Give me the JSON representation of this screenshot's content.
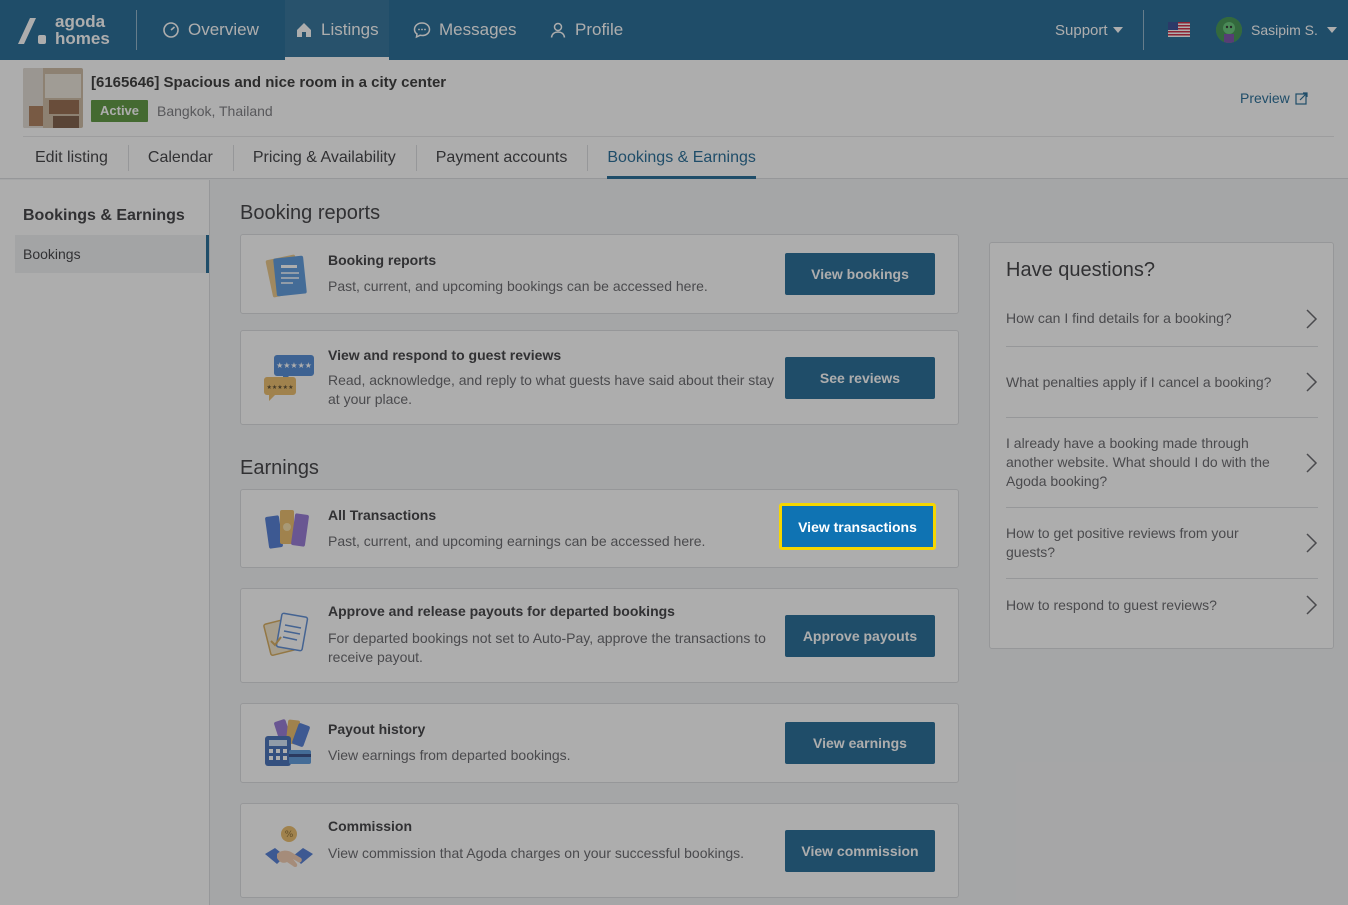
{
  "topnav": {
    "logo_line1": "agoda",
    "logo_line2": "homes",
    "items": [
      {
        "label": "Overview",
        "icon": "gauge-icon"
      },
      {
        "label": "Listings",
        "icon": "home-icon",
        "active": true
      },
      {
        "label": "Messages",
        "icon": "chat-icon"
      },
      {
        "label": "Profile",
        "icon": "person-icon"
      }
    ],
    "support_label": "Support",
    "user_name": "Sasipim S."
  },
  "listing": {
    "title": "[6165646] Spacious and nice room in a city center",
    "status": "Active",
    "location": "Bangkok, Thailand",
    "preview_label": "Preview",
    "tabs": [
      {
        "label": "Edit listing"
      },
      {
        "label": "Calendar"
      },
      {
        "label": "Pricing & Availability"
      },
      {
        "label": "Payment accounts"
      },
      {
        "label": "Bookings & Earnings",
        "active": true
      }
    ]
  },
  "sidebar": {
    "title": "Bookings & Earnings",
    "items": [
      {
        "label": "Bookings",
        "active": true
      }
    ]
  },
  "booking_reports": {
    "section_title": "Booking reports",
    "cards": [
      {
        "title": "Booking reports",
        "desc": "Past, current, and upcoming bookings can be accessed here.",
        "button": "View bookings",
        "icon": "document-icon"
      },
      {
        "title": "View and respond to guest reviews",
        "desc": "Read, acknowledge, and reply to what guests have said about their stay at your place.",
        "button": "See reviews",
        "icon": "reviews-icon"
      }
    ]
  },
  "earnings": {
    "section_title": "Earnings",
    "cards": [
      {
        "title": "All Transactions",
        "desc": "Past, current, and upcoming earnings can be accessed here.",
        "button": "View transactions",
        "icon": "cash-icon"
      },
      {
        "title": "Approve and release payouts for departed bookings",
        "desc": "For departed bookings not set to Auto-Pay, approve the transactions to receive payout.",
        "button": "Approve payouts",
        "icon": "clipboard-icon"
      },
      {
        "title": "Payout history",
        "desc": "View earnings from departed bookings.",
        "button": "View earnings",
        "icon": "calculator-icon"
      },
      {
        "title": "Commission",
        "desc": "View commission that Agoda charges on your successful bookings.",
        "button": "View commission",
        "icon": "handshake-icon"
      }
    ]
  },
  "questions": {
    "title": "Have questions?",
    "items": [
      "How can I find details for a booking?",
      "What penalties apply if I cancel a booking?",
      "I already have a booking made through another website. What should I do with the Agoda booking?",
      "How to get positive reviews from your guests?",
      "How to respond to guest reviews?"
    ]
  },
  "colors": {
    "brand": "#0c5a8a",
    "active_badge": "#4a8c2a",
    "focus_ring": "#f5d600",
    "overlay": "rgba(60,60,60,0.42)"
  }
}
